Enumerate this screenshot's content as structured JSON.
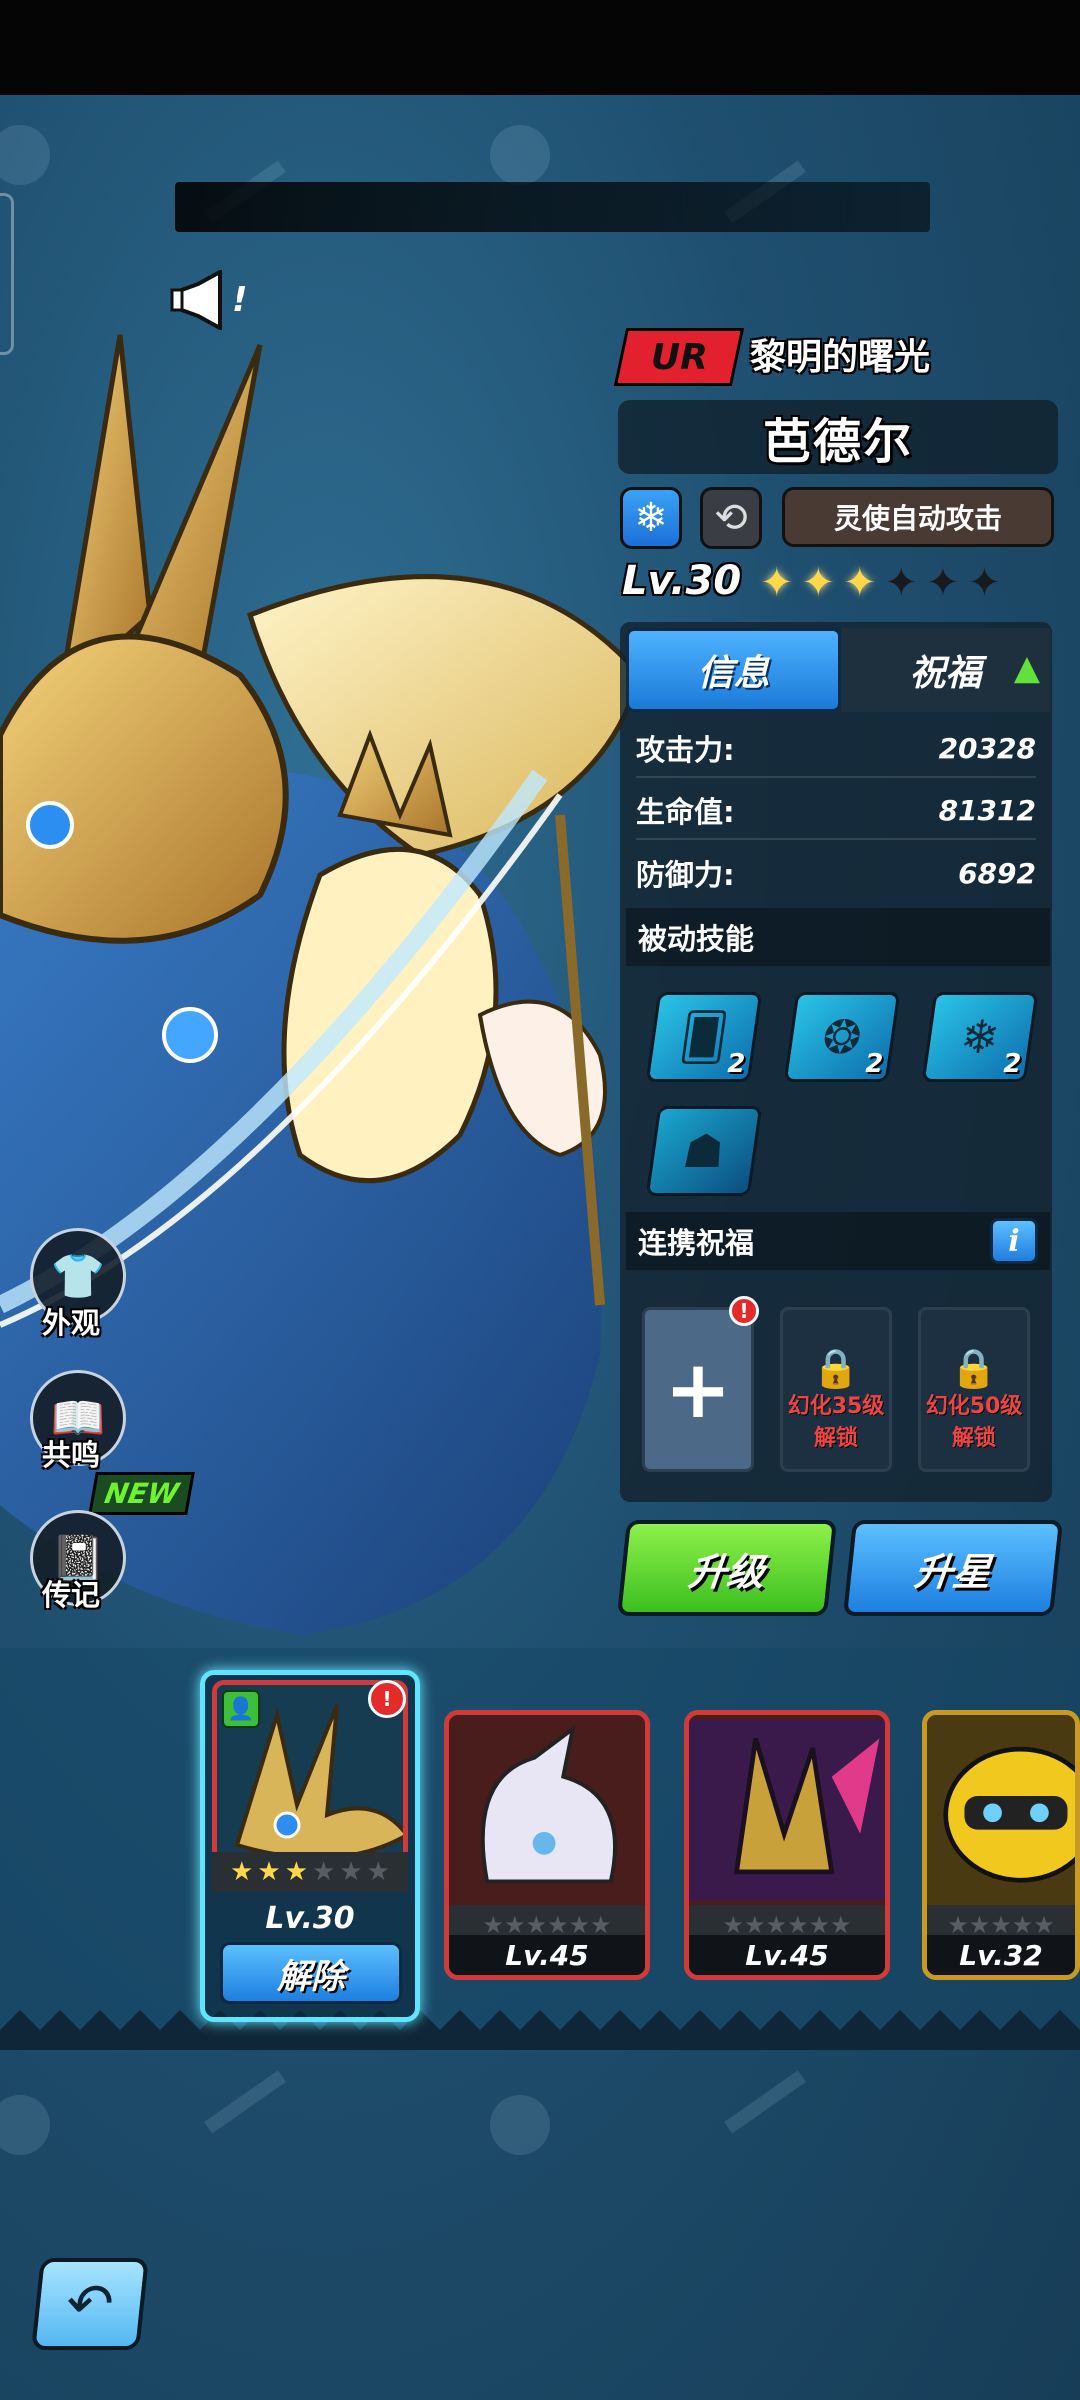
{
  "banner": {
    "exclamation": "!"
  },
  "hero": {
    "rarity": "UR",
    "subtitle": "黎明的曙光",
    "name": "芭德尔",
    "element_icon": "snowflake-icon",
    "auto_attack_label": "灵使自动攻击",
    "level": "Lv.30",
    "stars_filled": 3,
    "stars_total": 6
  },
  "tabs": [
    {
      "label": "信息",
      "active": true
    },
    {
      "label": "祝福",
      "active": false
    }
  ],
  "stats": [
    {
      "label": "攻击力:",
      "value": "20328"
    },
    {
      "label": "生命值:",
      "value": "81312"
    },
    {
      "label": "防御力:",
      "value": "6892"
    }
  ],
  "passive": {
    "title": "被动技能",
    "skills": [
      {
        "icon": "ice-cards-icon",
        "count": "2"
      },
      {
        "icon": "ice-boot-icon",
        "count": "2"
      },
      {
        "icon": "snowflake-icon",
        "count": "2"
      },
      {
        "icon": "hair-silhouette-icon",
        "count": ""
      }
    ]
  },
  "link": {
    "title": "连携祝福",
    "info_icon": "i",
    "slots": [
      {
        "type": "add",
        "symbol": "+",
        "badge": "!"
      },
      {
        "type": "locked",
        "line1": "幻化35级",
        "line2": "解锁"
      },
      {
        "type": "locked",
        "line1": "幻化50级",
        "line2": "解锁"
      }
    ]
  },
  "actions": {
    "upgrade": "升级",
    "star_up": "升星"
  },
  "side_buttons": [
    {
      "label": "外观",
      "icon": "shirt-icon"
    },
    {
      "label": "共鸣",
      "icon": "book-icon"
    },
    {
      "label": "传记",
      "icon": "journal-icon",
      "badge": "NEW"
    }
  ],
  "roster": {
    "selected": {
      "level": "Lv.30",
      "stars_filled": 3,
      "action": "解除",
      "badge": "!"
    },
    "cards": [
      {
        "level": "Lv.45",
        "frame": "red"
      },
      {
        "level": "Lv.45",
        "frame": "red"
      },
      {
        "level": "Lv.32",
        "frame": "gold"
      }
    ]
  },
  "colors": {
    "accent_blue": "#1d7fe0",
    "accent_green": "#3cc01f",
    "rarity_red": "#e2202e",
    "star_gold": "#ffd84a"
  }
}
